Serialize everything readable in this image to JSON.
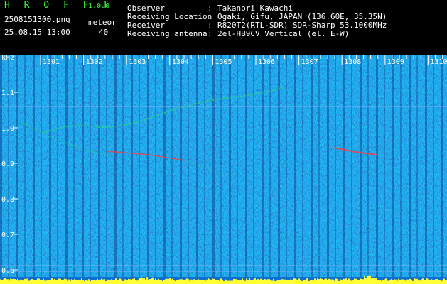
{
  "header": {
    "app_title": "H R O F F T",
    "version": "1.0.0",
    "filename": "2508151300.png",
    "meteor_label": "meteor",
    "datetime": "25.08.15 13:00",
    "meteor_count": "40"
  },
  "meta": [
    {
      "key": "Observer",
      "sep": ":",
      "value": "Takanori Kawachi"
    },
    {
      "key": "Receiving Location",
      "sep": ":",
      "value": "Ogaki, Gifu, JAPAN (136.60E, 35.35N)"
    },
    {
      "key": "Receiver",
      "sep": ":",
      "value": "R820T2(RTL-SDR) SDR-Sharp 53.1000MHz"
    },
    {
      "key": "Receiving antenna",
      "sep": ":",
      "value": "2el-HB9CV Vertical (el. E-W)"
    }
  ],
  "spectrogram": {
    "y_unit": "kHz",
    "y_ticks": [
      "1.1",
      "1.0",
      "0.9",
      "0.8",
      "0.7",
      "0.6"
    ],
    "x_ticks": [
      "1301",
      "1302",
      "1303",
      "1304",
      "1305",
      "1306",
      "1307",
      "1308",
      "1309",
      "1310"
    ],
    "colors": {
      "background": "#0a3f9e",
      "noise_dark": "#02147a",
      "noise_light": "#2f8fe0",
      "signal": "#2fd67a",
      "hot": "#ff3a3a",
      "power_bar": "#ffff33",
      "grid": "#b8b8ff"
    }
  }
}
